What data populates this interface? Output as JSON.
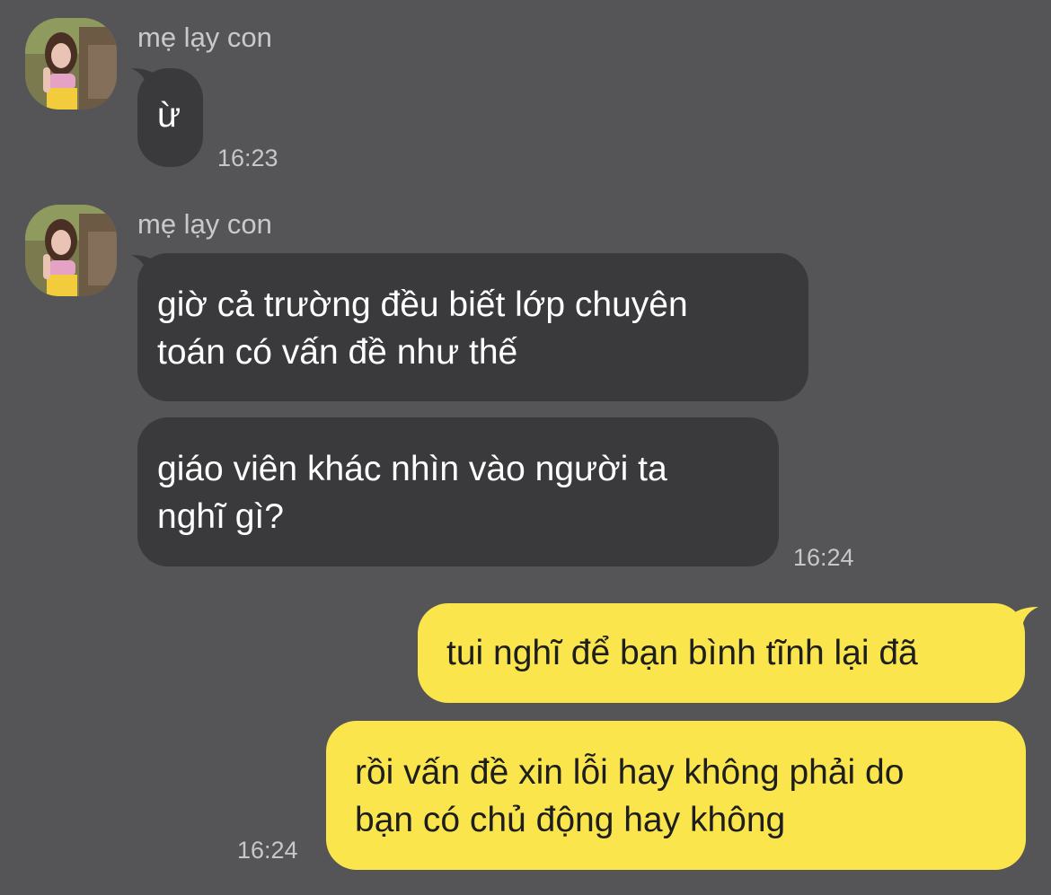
{
  "messages": [
    {
      "sender": "mẹ lạy con",
      "avatar_icon": "contact-avatar-icon",
      "bubbles": [
        "ừ"
      ],
      "time": "16:23"
    },
    {
      "sender": "mẹ lạy con",
      "avatar_icon": "contact-avatar-icon",
      "bubbles": [
        "giờ cả trường đều biết lớp chuyên\ntoán có vấn đề như thế",
        "giáo viên khác nhìn vào người ta\nnghĩ gì?"
      ],
      "time": "16:24"
    },
    {
      "sender": "me",
      "bubbles": [
        "tui nghĩ để bạn bình tĩnh lại đã",
        "rồi vấn đề xin lỗi hay không phải do\nbạn có chủ động hay không"
      ],
      "time": "16:24"
    }
  ],
  "colors": {
    "background": "#555457",
    "incoming_bubble": "#3a3a3c",
    "outgoing_bubble": "#fae54d",
    "incoming_text": "#ffffff",
    "outgoing_text": "#1e1e1e",
    "meta_text": "#c7c7cb"
  }
}
